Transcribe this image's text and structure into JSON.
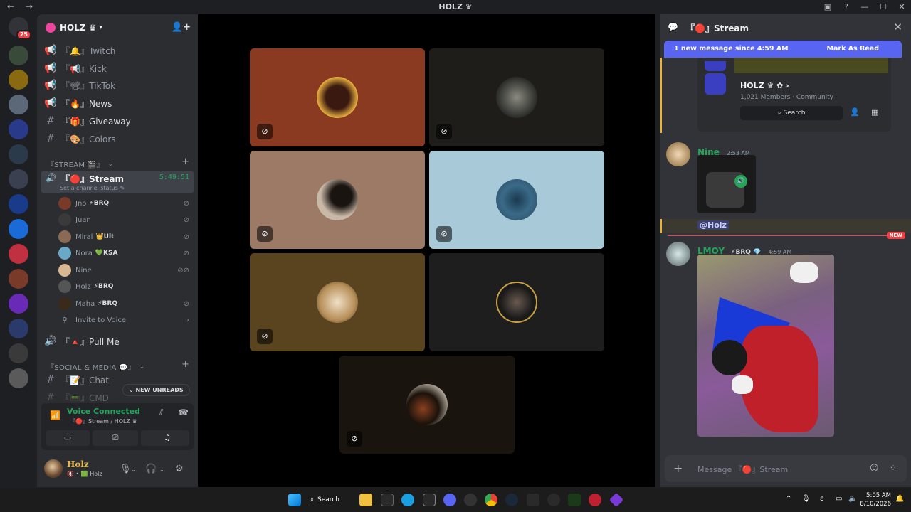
{
  "window": {
    "title": "HOLZ ♛",
    "nav": "← →",
    "controls": [
      "▣",
      "?",
      "—",
      "☐",
      "✕"
    ]
  },
  "rail": {
    "home_badge": "25"
  },
  "guild": {
    "name": "HOLZ ♛",
    "chevron": "▾"
  },
  "channels": [
    {
      "label": "『🔔』Twitch",
      "icon": "megaphone-icon"
    },
    {
      "label": "『📢』Kick",
      "icon": "megaphone-icon"
    },
    {
      "label": "『📽』TikTok",
      "icon": "megaphone-icon"
    },
    {
      "label": "『🔥』News",
      "icon": "megaphone-icon"
    },
    {
      "label": "『🎁』Giveaway",
      "icon": "hash-icon"
    },
    {
      "label": "『🎨』Colors",
      "icon": "hash-icon"
    }
  ],
  "categories": {
    "stream": "『STREAM 🎬』",
    "social": "『SOCIAL & MEDIA 💬』"
  },
  "active_channel": {
    "name": "『🔴』Stream",
    "time": "5:49:51",
    "status": "Set a channel status ✎"
  },
  "voice_users": [
    {
      "name": "Jno",
      "tag": "⚡BRQ",
      "color": "#7a3a2a"
    },
    {
      "name": "Juan",
      "tag": "",
      "color": "#3a3a3a"
    },
    {
      "name": "Miral",
      "tag": "👑Ult",
      "color": "#8a6a55"
    },
    {
      "name": "Nora",
      "tag": "💚KSA",
      "color": "#6aa8c8"
    },
    {
      "name": "Nine",
      "tag": "",
      "color": "#d8b890"
    },
    {
      "name": "Holz",
      "tag": "⚡BRQ",
      "color": "#555555"
    },
    {
      "name": "Maha",
      "tag": "⚡BRQ",
      "color": "#3a2a1a"
    }
  ],
  "invite_to_voice": "Invite to Voice",
  "pull_me": "『🔺』Pull Me",
  "chat_channel": "『📝』Chat",
  "cmd_channel": "『📟』CMD",
  "new_unreads": "⌄ NEW UNREADS",
  "voice": {
    "connected": "Voice Connected",
    "sub": "『🔴』Stream / HOLZ ♛"
  },
  "user": {
    "name": "Holz",
    "sub": "🔇 • 🟩 Holz"
  },
  "chat": {
    "header": "『🔴』Stream",
    "new_since": "1 new message since 4:59 AM",
    "mark_read": "Mark As Read",
    "embed": {
      "server": "HOLZ ♛ ✿ ›",
      "members": "1,021 Members · Community",
      "search": "Search"
    },
    "msg1": {
      "user": "Nine",
      "time": "2:53 AM"
    },
    "mention": "@Holz",
    "new_tag": "NEW",
    "msg2": {
      "user": "LMOY",
      "tag": "⚡BRQ 💎",
      "time": "4:59 AM"
    },
    "composer": "Message 『🔴』Stream"
  },
  "taskbar": {
    "search": "Search",
    "time": "5:05 AM",
    "date": "8/10/2026"
  }
}
